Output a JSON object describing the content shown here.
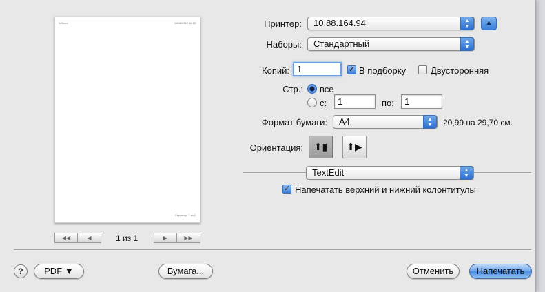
{
  "preview": {
    "header_left": "Without",
    "header_right": "10/08/2010 16:15",
    "footer_right": "Страница 1 из 1",
    "page_count": "1 из 1",
    "nav": {
      "first": "◀◀",
      "prev": "◀",
      "next": "▶",
      "last": "▶▶"
    }
  },
  "printer": {
    "label": "Принтер:",
    "value": "10.88.164.94",
    "disclosure_icon": "▲"
  },
  "presets": {
    "label": "Наборы:",
    "value": "Стандартный"
  },
  "copies": {
    "label": "Копий:",
    "value": "1",
    "collated_label": "В подборку",
    "collated_checked": true,
    "two_sided_label": "Двусторонняя",
    "two_sided_checked": false
  },
  "pages": {
    "label": "Стр.:",
    "all_label": "все",
    "from_label": "с:",
    "from_value": "1",
    "to_label": "по:",
    "to_value": "1"
  },
  "paper_size": {
    "label": "Формат бумаги:",
    "value": "A4",
    "dimensions": "20,99 на 29,70 см."
  },
  "orientation": {
    "label": "Ориентация:",
    "portrait_icon": "portrait-icon",
    "landscape_icon": "landscape-icon"
  },
  "app_panel": {
    "value": "TextEdit",
    "header_footer_label": "Напечатать верхний и нижний колонтитулы",
    "header_footer_checked": true
  },
  "footer": {
    "help": "?",
    "pdf": "PDF ▼",
    "paper_button": "Бумага...",
    "cancel": "Отменить",
    "print": "Напечатать"
  },
  "colors": {
    "accent": "#3a7ed8",
    "sheet_bg": "#e8e8e8"
  }
}
